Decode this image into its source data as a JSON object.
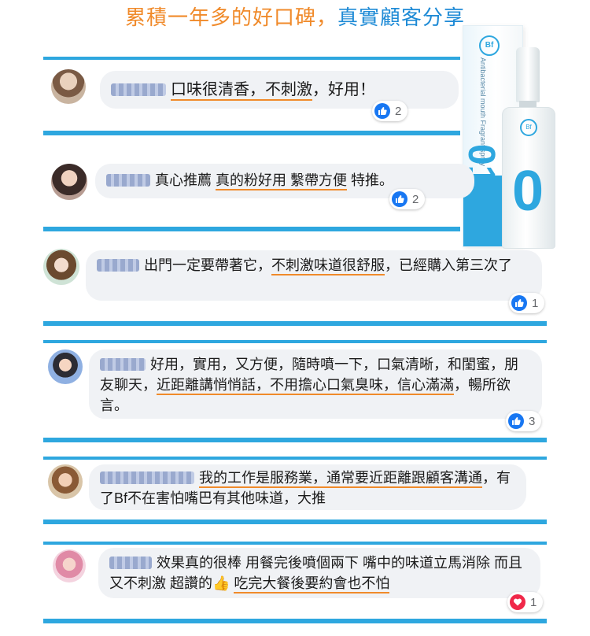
{
  "header": {
    "title_orange": "累積一年多的好口碑，",
    "title_blue": "真實顧客分享"
  },
  "product": {
    "box_logo": "Bf",
    "box_text": "Antibacterial mouth Fragrant spray",
    "box_number": "01",
    "bottle_logo": "Bf",
    "bottle_number": "0"
  },
  "comments": [
    {
      "segments": [
        {
          "t": "口味很清香，不刺激",
          "u": true
        },
        {
          "t": "，好用！",
          "u": false
        }
      ],
      "reaction": "like",
      "count": "2"
    },
    {
      "segments": [
        {
          "t": "真心推薦 ",
          "u": false
        },
        {
          "t": "真的粉好用 繫帶方便",
          "u": true
        },
        {
          "t": " 特推。",
          "u": false
        }
      ],
      "reaction": "like",
      "count": "2"
    },
    {
      "segments": [
        {
          "t": "出門一定要帶著它，",
          "u": false
        },
        {
          "t": "不刺激味道很舒服",
          "u": true
        },
        {
          "t": "，已經購入第三次了",
          "u": false
        }
      ],
      "reaction": "like",
      "count": "1"
    },
    {
      "segments": [
        {
          "t": "好用，實用，又方便，隨時噴一下，口氣清晰，和閨蜜，朋友聊天，",
          "u": false
        },
        {
          "t": "近距離講悄悄話，不用擔心口氣臭味，信心滿滿",
          "u": true
        },
        {
          "t": "，暢所欲言。",
          "u": false
        }
      ],
      "reaction": "like",
      "count": "3"
    },
    {
      "segments": [
        {
          "t": "我的工作是服務業，通常要近距離跟顧客溝通",
          "u": true
        },
        {
          "t": "，有了Bf不在害怕嘴巴有其他味道，大推",
          "u": false
        }
      ],
      "reaction": "none",
      "count": ""
    },
    {
      "segments": [
        {
          "t": "效果真的很棒 用餐完後噴個兩下 嘴中的味道立馬消除 而且又不刺激 超讚的👍 ",
          "u": false
        },
        {
          "t": "吃完大餐後要約會也不怕",
          "u": true
        }
      ],
      "reaction": "heart",
      "count": "1"
    }
  ],
  "colors": {
    "accent_orange": "#f08a2a",
    "accent_blue": "#2ea7df",
    "like_blue": "#1877f2",
    "heart_red": "#f02849"
  }
}
